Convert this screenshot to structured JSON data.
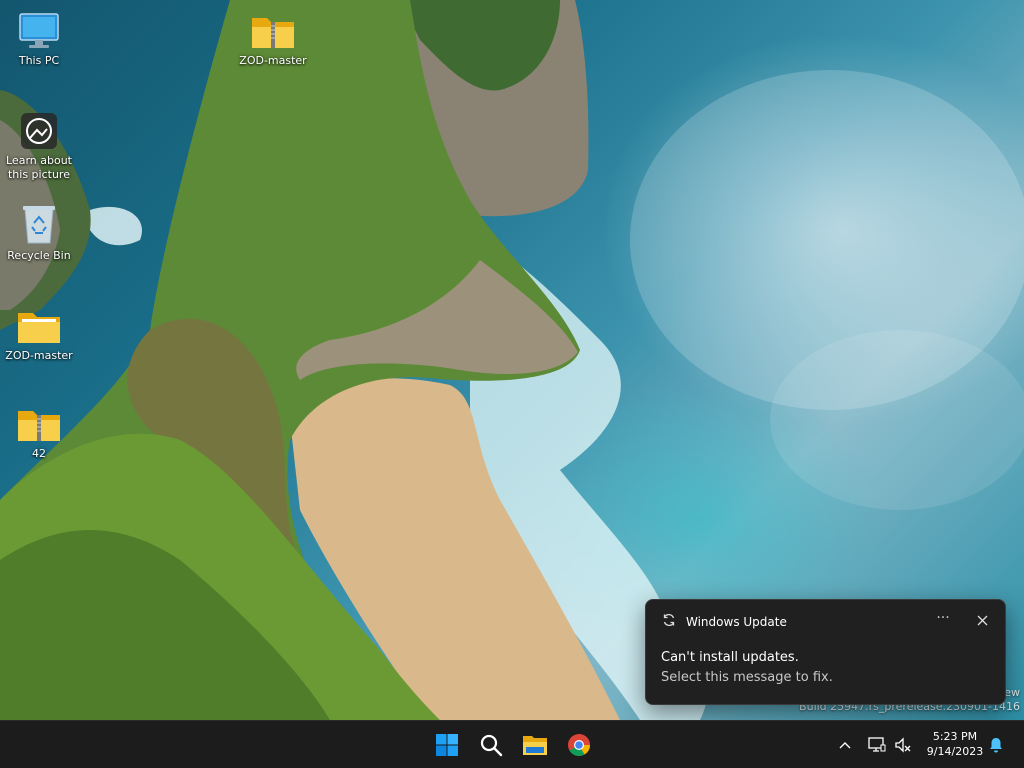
{
  "desktop": {
    "icons": [
      {
        "label": "This PC",
        "icon": "monitor-icon"
      },
      {
        "label": "Learn about\nthis picture",
        "icon": "camera-icon"
      },
      {
        "label": "Recycle Bin",
        "icon": "recycle-bin-icon"
      },
      {
        "label": "ZOD-master",
        "icon": "folder-icon"
      },
      {
        "label": "42",
        "icon": "zip-folder-icon"
      },
      {
        "label": "ZOD-master",
        "icon": "zip-folder-icon"
      }
    ]
  },
  "notification": {
    "app_name": "Windows Update",
    "title": "Can't install updates.",
    "body": "Select this message to fix.",
    "more_label": "···"
  },
  "watermark": {
    "line1": "ew",
    "line2": "Build 25947.rs_prerelease.230901-1416"
  },
  "taskbar": {
    "clock_time": "5:23 PM",
    "clock_date": "9/14/2023"
  },
  "colors": {
    "taskbar_bg": "#1c1c1c",
    "toast_bg": "#202020",
    "start_blue": "#1ea0f5",
    "folder_yellow": "#f4c430"
  }
}
